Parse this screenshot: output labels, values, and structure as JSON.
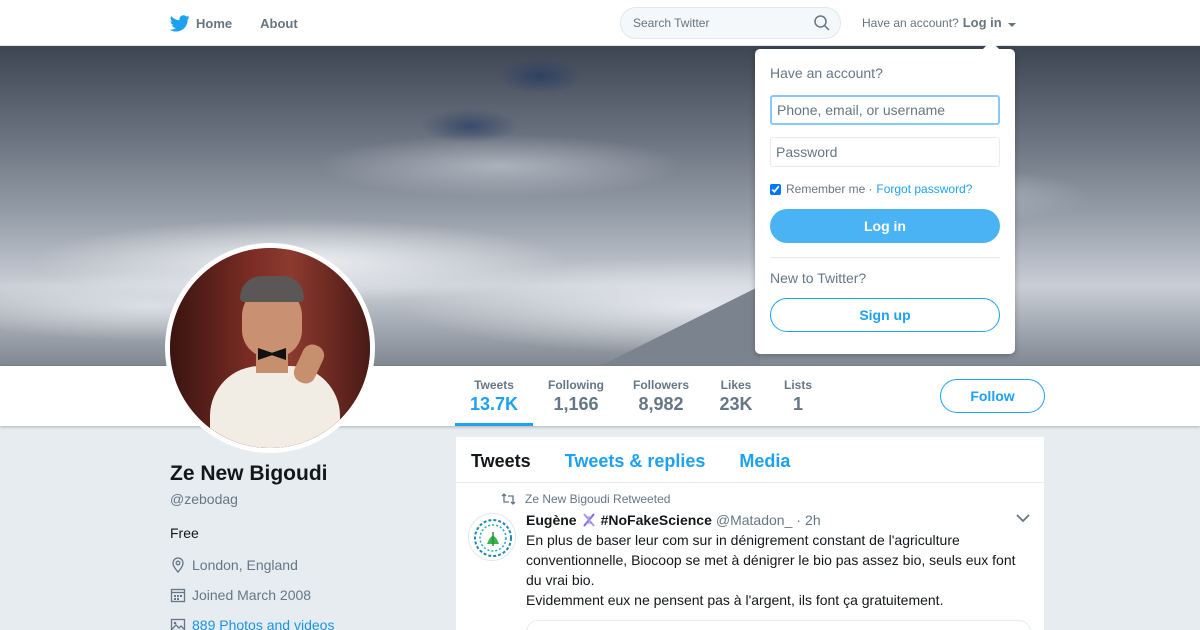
{
  "topbar": {
    "home_label": "Home",
    "about_label": "About",
    "search_placeholder": "Search Twitter",
    "account_prompt": "Have an account?",
    "login_label": "Log in"
  },
  "login_dropdown": {
    "title": "Have an account?",
    "username_placeholder": "Phone, email, or username",
    "password_placeholder": "Password",
    "remember_label": "Remember me",
    "separator": "·",
    "forgot_label": "Forgot password?",
    "remember_checked": true,
    "login_button": "Log in",
    "new_prompt": "New to Twitter?",
    "signup_button": "Sign up"
  },
  "profile_nav": {
    "stats": [
      {
        "label": "Tweets",
        "value": "13.7K",
        "active": true
      },
      {
        "label": "Following",
        "value": "1,166"
      },
      {
        "label": "Followers",
        "value": "8,982"
      },
      {
        "label": "Likes",
        "value": "23K"
      },
      {
        "label": "Lists",
        "value": "1"
      }
    ],
    "follow_button": "Follow"
  },
  "profile": {
    "name": "Ze New Bigoudi",
    "handle": "@zebodag",
    "bio": "Free",
    "location": "London, England",
    "joined": "Joined March 2008",
    "photos_link": "889 Photos and videos"
  },
  "timeline": {
    "tabs": [
      {
        "label": "Tweets",
        "active": true
      },
      {
        "label": "Tweets & replies"
      },
      {
        "label": "Media"
      }
    ],
    "tweet": {
      "retweet_context": "Ze New Bigoudi Retweeted",
      "author_name": "Eugène",
      "author_hashtag": "#NoFakeScience",
      "author_handle": "@Matadon_",
      "dot": "·",
      "time": "2h",
      "text_lines": [
        "En plus de baser leur com sur in dénigrement constant de l'agriculture conventionnelle, Biocoop se met à dénigrer le bio pas assez bio, seuls eux font du vrai bio.",
        "Evidemment eux ne pensent pas à l'argent, ils font ça gratuitement."
      ]
    }
  },
  "colors": {
    "accent": "#1da1f2",
    "login_button_bg": "#4ab3f4",
    "page_bg": "#e6ecf0",
    "text_secondary": "#657786"
  },
  "icons": {
    "home": "twitter-bird-icon",
    "search": "search-icon",
    "location": "location-pin-icon",
    "calendar": "calendar-icon",
    "photos": "photo-icon",
    "retweet": "retweet-icon",
    "dna": "dna-icon",
    "chevron": "chevron-down-icon"
  }
}
